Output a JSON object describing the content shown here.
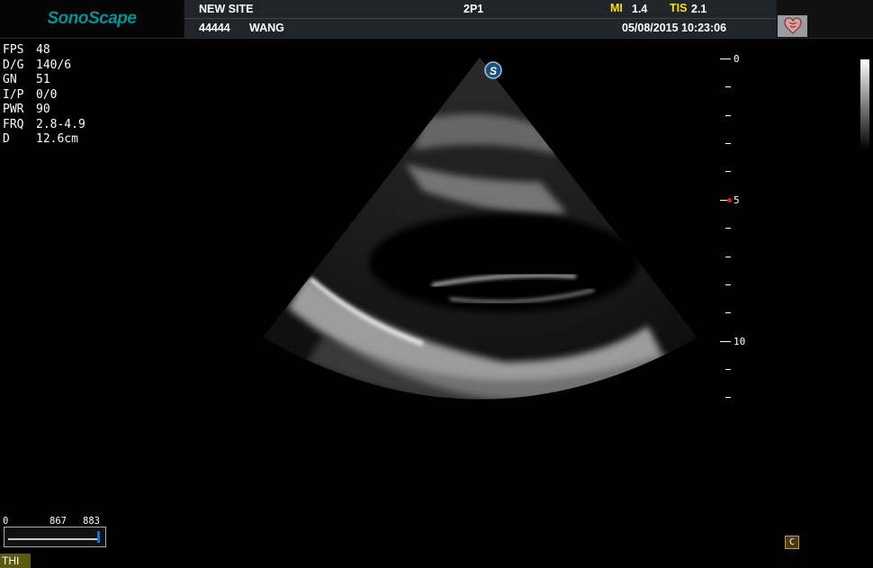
{
  "header": {
    "logo": "SonoScape",
    "hospital": "NEW SITE",
    "probe": "2P1",
    "mi_label": "MI",
    "mi_value": "1.4",
    "tis_label": "TIS",
    "tis_value": "2.1",
    "patient_id": "44444",
    "patient_name": "WANG",
    "datetime": "05/08/2015 10:23:06",
    "exam_icon": "heart-icon"
  },
  "params": [
    {
      "label": "FPS",
      "value": "48"
    },
    {
      "label": "D/G",
      "value": "140/6"
    },
    {
      "label": "GN",
      "value": "51"
    },
    {
      "label": "I/P",
      "value": "0/0"
    },
    {
      "label": "PWR",
      "value": "90"
    },
    {
      "label": "FRQ",
      "value": "2.8-4.9"
    },
    {
      "label": "D",
      "value": "12.6cm"
    }
  ],
  "scan": {
    "brand_marker": "S"
  },
  "depth_scale": {
    "labels": [
      "0",
      "5",
      "10"
    ]
  },
  "cine": {
    "start": "0",
    "current": "867",
    "end": "883"
  },
  "bottom": {
    "thi_label": "THI",
    "c_label": "C"
  }
}
